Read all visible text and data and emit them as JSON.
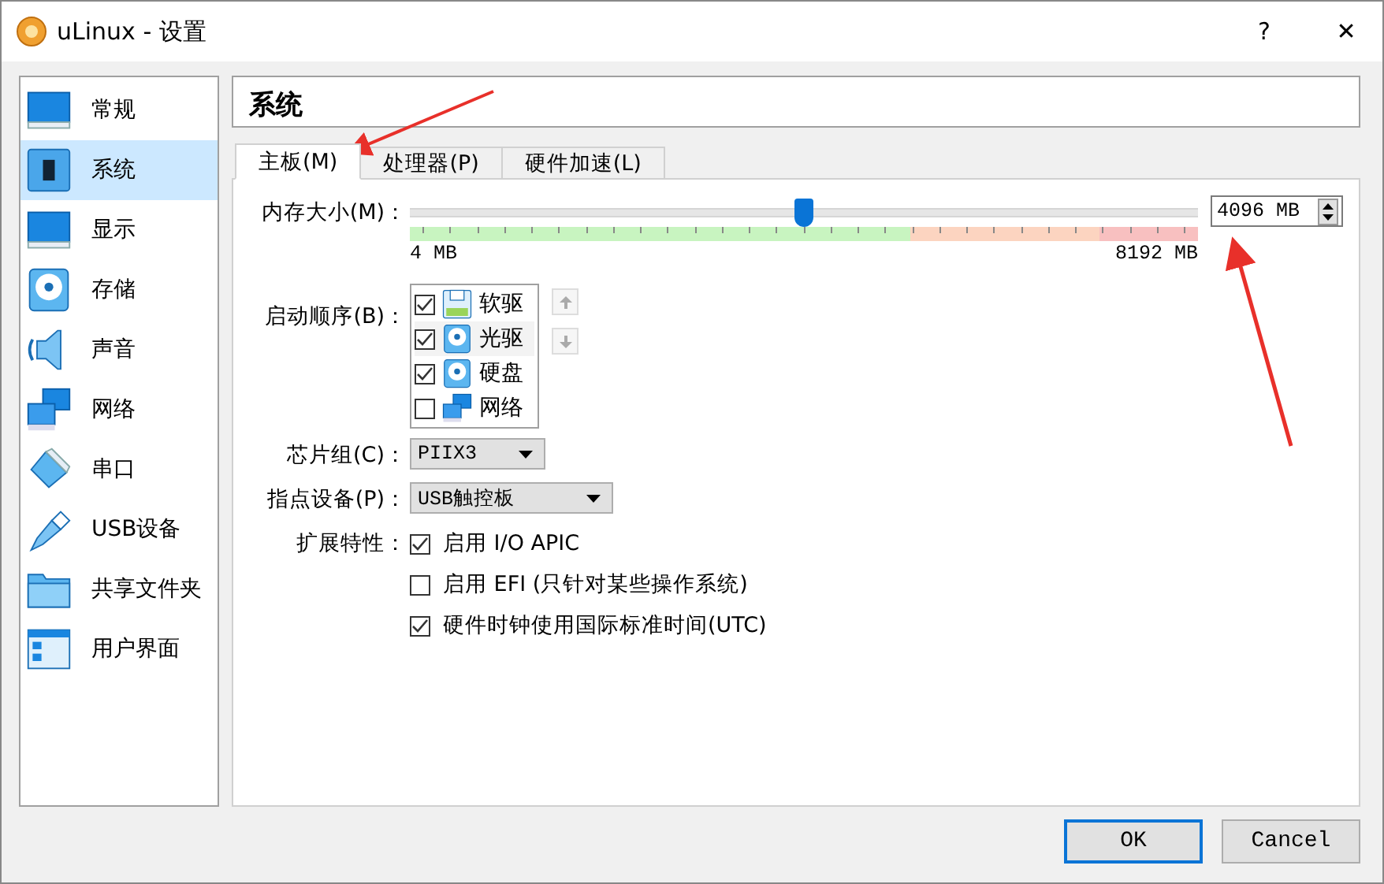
{
  "window": {
    "title": "uLinux - 设置",
    "help": "?",
    "close": "✕"
  },
  "sidebar": {
    "items": [
      {
        "label": "常规",
        "selected": false
      },
      {
        "label": "系统",
        "selected": true
      },
      {
        "label": "显示",
        "selected": false
      },
      {
        "label": "存储",
        "selected": false
      },
      {
        "label": "声音",
        "selected": false
      },
      {
        "label": "网络",
        "selected": false
      },
      {
        "label": "串口",
        "selected": false
      },
      {
        "label": "USB设备",
        "selected": false
      },
      {
        "label": "共享文件夹",
        "selected": false
      },
      {
        "label": "用户界面",
        "selected": false
      }
    ]
  },
  "page_title": "系统",
  "tabs": [
    {
      "label": "主板(M)",
      "selected": true
    },
    {
      "label": "处理器(P)",
      "selected": false
    },
    {
      "label": "硬件加速(L)",
      "selected": false
    }
  ],
  "memory": {
    "label": "内存大小(M)：",
    "level": 0.5,
    "min_label": "4 MB",
    "max_label": "8192 MB",
    "value": "4096 MB"
  },
  "boot_order": {
    "label": "启动顺序(B)：",
    "items": [
      {
        "label": "软驱",
        "checked": true,
        "selected": false
      },
      {
        "label": "光驱",
        "checked": true,
        "selected": true
      },
      {
        "label": "硬盘",
        "checked": true,
        "selected": false
      },
      {
        "label": "网络",
        "checked": false,
        "selected": false
      }
    ]
  },
  "chipset": {
    "label": "芯片组(C)：",
    "value": "PIIX3"
  },
  "pointing_device": {
    "label": "指点设备(P)：",
    "value": "USB触控板"
  },
  "extended_features": {
    "label": "扩展特性：",
    "items": [
      {
        "label": "启用 I/O APIC",
        "checked": true
      },
      {
        "label": "启用 EFI (只针对某些操作系统)",
        "checked": false
      },
      {
        "label": "硬件时钟使用国际标准时间(UTC)",
        "checked": true
      }
    ]
  },
  "buttons": [
    {
      "label": "OK",
      "default": true
    },
    {
      "label": "Cancel",
      "default": false
    }
  ]
}
